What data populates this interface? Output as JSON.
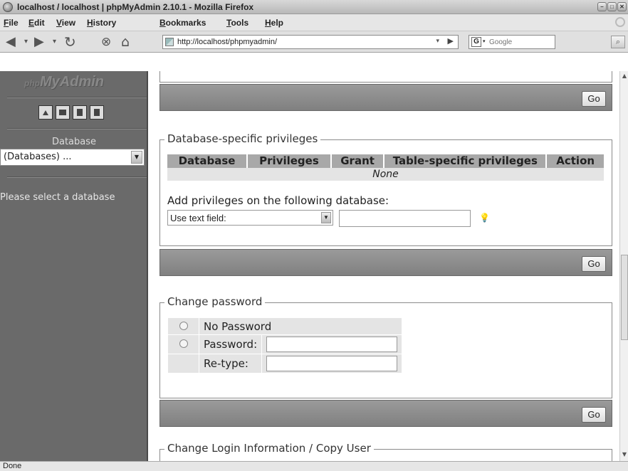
{
  "window": {
    "title": "localhost / localhost | phpMyAdmin 2.10.1 - Mozilla Firefox"
  },
  "menu": {
    "items": [
      "File",
      "Edit",
      "View",
      "History",
      "Bookmarks",
      "Tools",
      "Help"
    ]
  },
  "nav": {
    "url": "http://localhost/phpmyadmin/",
    "search_placeholder": "Google"
  },
  "sidebar": {
    "logo": {
      "prefix": "php",
      "name": "MyAdmin"
    },
    "database_label": "Database",
    "database_select": "(Databases) ...",
    "hint": "Please select a database"
  },
  "db_privileges": {
    "legend": "Database-specific privileges",
    "columns": [
      "Database",
      "Privileges",
      "Grant",
      "Table-specific privileges",
      "Action"
    ],
    "empty_text": "None",
    "add_label": "Add privileges on the following database:",
    "add_select": "Use text field:",
    "go_label": "Go"
  },
  "top_footer": {
    "go_label": "Go"
  },
  "change_password": {
    "legend": "Change password",
    "no_password": "No Password",
    "password_label": "Password:",
    "retype_label": "Re-type:",
    "go_label": "Go"
  },
  "change_login": {
    "legend": "Change Login Information / Copy User"
  },
  "status": {
    "text": "Done"
  }
}
